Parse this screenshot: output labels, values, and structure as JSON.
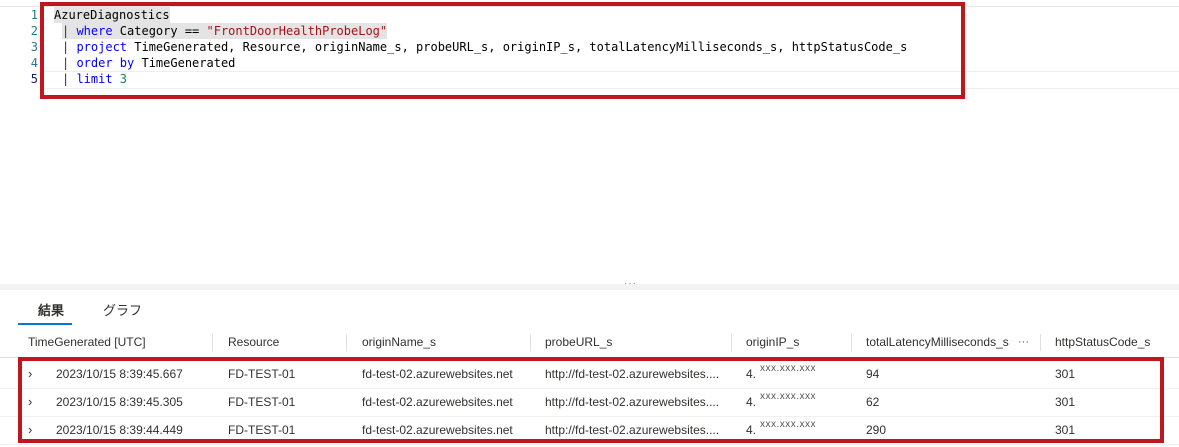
{
  "editor": {
    "line_numbers": [
      "1",
      "2",
      "3",
      "4",
      "5"
    ],
    "lines": {
      "l1": {
        "text": "AzureDiagnostics"
      },
      "l2": {
        "pipe": "| ",
        "kw": "where",
        "mid": " Category == ",
        "str": "\"FrontDoorHealthProbeLog\""
      },
      "l3": {
        "pipe": "| ",
        "kw": "project",
        "rest": " TimeGenerated, Resource, originName_s, probeURL_s, originIP_s, totalLatencyMilliseconds_s, httpStatusCode_s"
      },
      "l4": {
        "pipe": "| ",
        "kw": "order by",
        "rest": " TimeGenerated"
      },
      "l5": {
        "pipe": "| ",
        "kw": "limit",
        "num": " 3"
      }
    }
  },
  "splitter": {
    "handle": "···"
  },
  "tabs": {
    "results": "結果",
    "chart": "グラフ"
  },
  "grid": {
    "columns": {
      "time": "TimeGenerated [UTC]",
      "resource": "Resource",
      "origin_name": "originName_s",
      "probe_url": "probeURL_s",
      "origin_ip": "originIP_s",
      "latency": "totalLatencyMilliseconds_s",
      "status": "httpStatusCode_s"
    },
    "column_more": "···",
    "expand_glyph": "›",
    "rows": [
      {
        "time": "2023/10/15 8:39:45.667",
        "resource": "FD-TEST-01",
        "origin_name": "fd-test-02.azurewebsites.net",
        "probe_url": "http://fd-test-02.azurewebsites....",
        "ip_prefix": "4.",
        "ip_mask": "xxx.xxx.xxx",
        "latency": "94",
        "status": "301"
      },
      {
        "time": "2023/10/15 8:39:45.305",
        "resource": "FD-TEST-01",
        "origin_name": "fd-test-02.azurewebsites.net",
        "probe_url": "http://fd-test-02.azurewebsites....",
        "ip_prefix": "4.",
        "ip_mask": "xxx.xxx.xxx",
        "latency": "62",
        "status": "301"
      },
      {
        "time": "2023/10/15 8:39:44.449",
        "resource": "FD-TEST-01",
        "origin_name": "fd-test-02.azurewebsites.net",
        "probe_url": "http://fd-test-02.azurewebsites....",
        "ip_prefix": "4.",
        "ip_mask": "xxx.xxx.xxx",
        "latency": "290",
        "status": "301"
      }
    ]
  },
  "colors": {
    "annotation_box": "#c0161f",
    "tab_underline": "#0078d4",
    "keyword": "#0000ff",
    "string": "#a31515",
    "number": "#098658",
    "line_number": "#237893"
  }
}
